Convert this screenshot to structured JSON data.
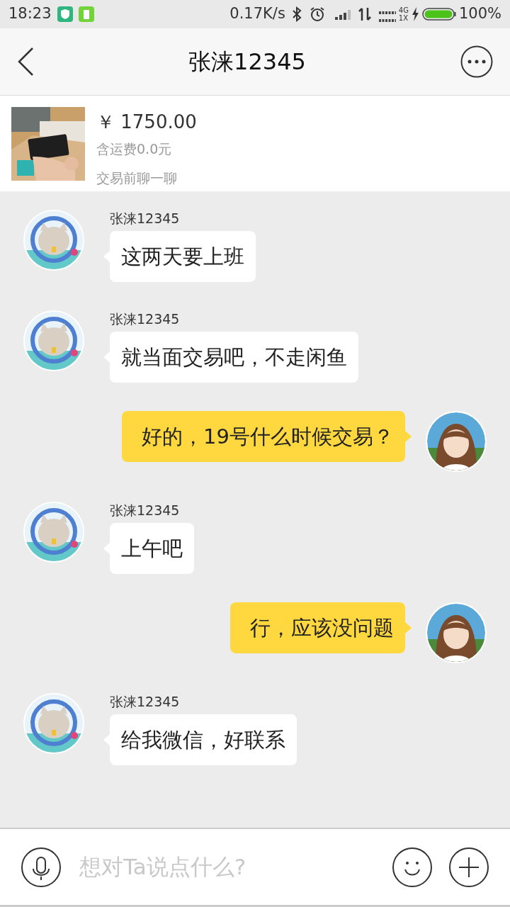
{
  "status_bar": {
    "time": "18:23",
    "speed": "0.17K/s",
    "network_top": "4G",
    "network_bottom": "1X",
    "battery": "100%"
  },
  "header": {
    "title": "张涞12345"
  },
  "product": {
    "kind": "picture",
    "price": "￥ 1750.00",
    "shipping": "含运费0.0元",
    "note": "交易前聊一聊"
  },
  "messages": [
    {
      "kind": "incoming",
      "sender": "张涞12345",
      "text": "这两天要上班"
    },
    {
      "kind": "incoming",
      "sender": "张涞12345",
      "text": "就当面交易吧，不走闲鱼"
    },
    {
      "kind": "outgoing",
      "text": "好的，19号什么时候交易？"
    },
    {
      "kind": "incoming",
      "sender": "张涞12345",
      "text": "上午吧"
    },
    {
      "kind": "outgoing",
      "text": "行，应该没问题"
    },
    {
      "kind": "incoming",
      "sender": "张涞12345",
      "text": "给我微信，好联系"
    }
  ],
  "input": {
    "placeholder": "想对Ta说点什么?"
  }
}
